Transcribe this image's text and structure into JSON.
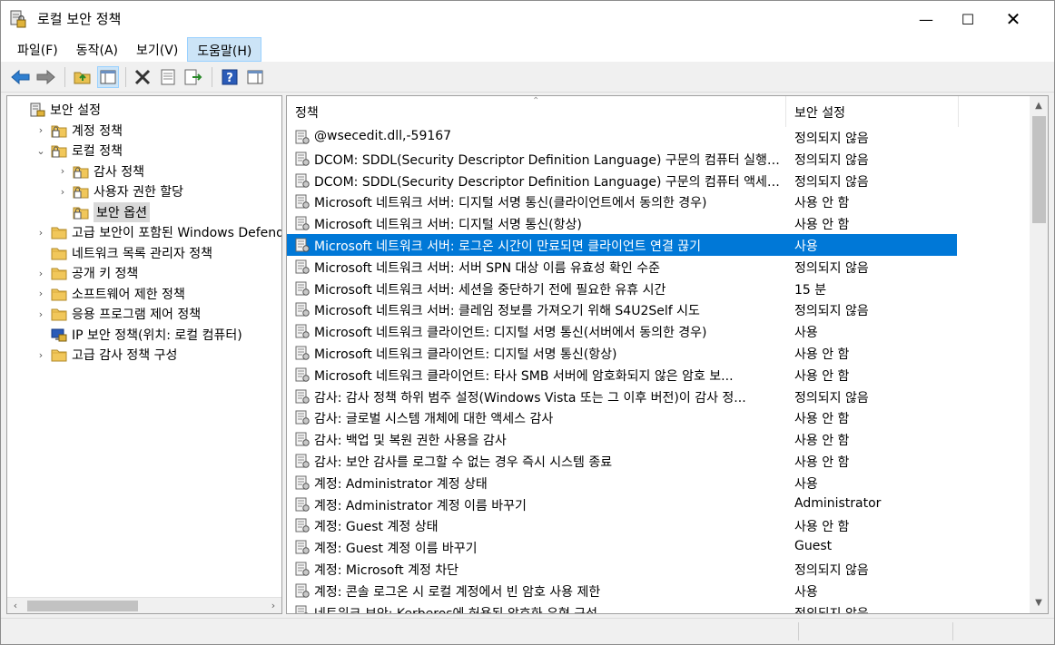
{
  "window": {
    "title": "로컬 보안 정책",
    "minimize": "—",
    "maximize": "☐",
    "close": "✕"
  },
  "menu": [
    {
      "label": "파일(F)"
    },
    {
      "label": "동작(A)"
    },
    {
      "label": "보기(V)"
    },
    {
      "label": "도움말(H)"
    }
  ],
  "toolbar": [
    "back-icon",
    "forward-icon",
    "up-folder-icon",
    "show-hide-tree-icon",
    "delete-icon",
    "properties-icon",
    "export-list-icon",
    "help-icon",
    "action-pane-icon"
  ],
  "tree": [
    {
      "label": "보안 설정",
      "expander": "",
      "icon": "security-settings-icon",
      "level": 0
    },
    {
      "label": "계정 정책",
      "expander": "›",
      "icon": "folder-lock-icon",
      "level": 1
    },
    {
      "label": "로컬 정책",
      "expander": "⌄",
      "icon": "folder-lock-icon",
      "level": 1
    },
    {
      "label": "감사 정책",
      "expander": "›",
      "icon": "folder-lock-icon",
      "level": 2
    },
    {
      "label": "사용자 권한 할당",
      "expander": "›",
      "icon": "folder-lock-icon",
      "level": 2
    },
    {
      "label": "보안 옵션",
      "expander": "",
      "icon": "folder-lock-icon",
      "level": 2,
      "selected": true
    },
    {
      "label": "고급 보안이 포함된 Windows Defender",
      "expander": "›",
      "icon": "folder-icon",
      "level": 1
    },
    {
      "label": "네트워크 목록 관리자 정책",
      "expander": "",
      "icon": "folder-icon",
      "level": 1
    },
    {
      "label": "공개 키 정책",
      "expander": "›",
      "icon": "folder-icon",
      "level": 1
    },
    {
      "label": "소프트웨어 제한 정책",
      "expander": "›",
      "icon": "folder-icon",
      "level": 1
    },
    {
      "label": "응용 프로그램 제어 정책",
      "expander": "›",
      "icon": "folder-icon",
      "level": 1
    },
    {
      "label": "IP 보안 정책(위치: 로컬 컴퓨터)",
      "expander": "",
      "icon": "ip-security-icon",
      "level": 1
    },
    {
      "label": "고급 감사 정책 구성",
      "expander": "›",
      "icon": "folder-icon",
      "level": 1
    }
  ],
  "list": {
    "columns": {
      "policy": "정책",
      "setting": "보안 설정"
    },
    "rows": [
      {
        "name": "@wsecedit.dll,-59167",
        "value": "정의되지 않음"
      },
      {
        "name": "DCOM: SDDL(Security Descriptor Definition Language) 구문의 컴퓨터 실행 ...",
        "value": "정의되지 않음"
      },
      {
        "name": "DCOM: SDDL(Security Descriptor Definition Language) 구문의 컴퓨터 액세스...",
        "value": "정의되지 않음"
      },
      {
        "name": "Microsoft 네트워크 서버: 디지털 서명 통신(클라이언트에서 동의한 경우)",
        "value": "사용 안 함"
      },
      {
        "name": "Microsoft 네트워크 서버: 디지털 서명 통신(항상)",
        "value": "사용 안 함"
      },
      {
        "name": "Microsoft 네트워크 서버: 로그온 시간이 만료되면 클라이언트 연결 끊기",
        "value": "사용",
        "selected": true
      },
      {
        "name": "Microsoft 네트워크 서버: 서버 SPN 대상 이름 유효성 확인 수준",
        "value": "정의되지 않음"
      },
      {
        "name": "Microsoft 네트워크 서버: 세션을 중단하기 전에 필요한 유휴 시간",
        "value": "15 분"
      },
      {
        "name": "Microsoft 네트워크 서버: 클레임 정보를 가져오기 위해 S4U2Self 시도",
        "value": "정의되지 않음"
      },
      {
        "name": "Microsoft 네트워크 클라이언트: 디지털 서명 통신(서버에서 동의한 경우)",
        "value": "사용"
      },
      {
        "name": "Microsoft 네트워크 클라이언트: 디지털 서명 통신(항상)",
        "value": "사용 안 함"
      },
      {
        "name": "Microsoft 네트워크 클라이언트: 타사 SMB 서버에 암호화되지 않은 암호 보...",
        "value": "사용 안 함"
      },
      {
        "name": "감사: 감사 정책 하위 범주 설정(Windows Vista 또는 그 이후 버전)이 감사 정...",
        "value": "정의되지 않음"
      },
      {
        "name": "감사: 글로벌 시스템 개체에 대한 액세스 감사",
        "value": "사용 안 함"
      },
      {
        "name": "감사: 백업 및 복원 권한 사용을 감사",
        "value": "사용 안 함"
      },
      {
        "name": "감사: 보안 감사를 로그할 수 없는 경우 즉시 시스템 종료",
        "value": "사용 안 함"
      },
      {
        "name": "계정: Administrator 계정 상태",
        "value": "사용"
      },
      {
        "name": "계정: Administrator 계정 이름 바꾸기",
        "value": "Administrator"
      },
      {
        "name": "계정: Guest 계정 상태",
        "value": "사용 안 함"
      },
      {
        "name": "계정: Guest 계정 이름 바꾸기",
        "value": "Guest"
      },
      {
        "name": "계정: Microsoft 계정 차단",
        "value": "정의되지 않음"
      },
      {
        "name": "계정: 콘솔 로그온 시 로컬 계정에서 빈 암호 사용 제한",
        "value": "사용"
      },
      {
        "name": "네트워크 보안: Kerberos에 허용된 암호화 유형 구성",
        "value": "정의되지 않음"
      }
    ]
  },
  "colors": {
    "selection": "#0078d7",
    "menu_active": "#cce4f7",
    "tree_selected": "#d9d9d9"
  }
}
